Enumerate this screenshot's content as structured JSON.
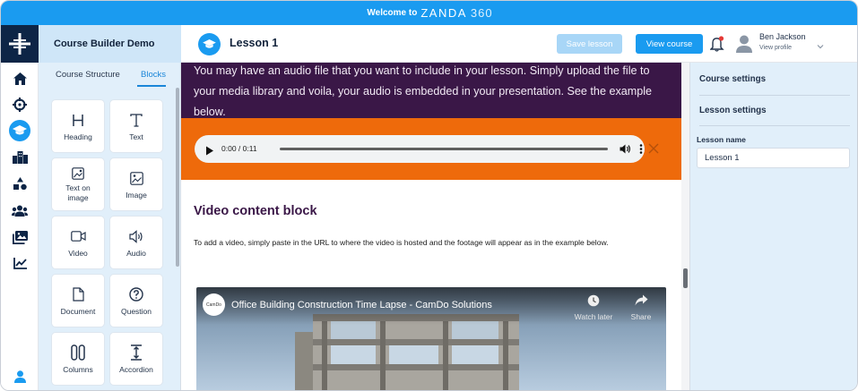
{
  "banner": {
    "welcome": "Welcome to",
    "brand": "ZANDA",
    "brand_num": "360"
  },
  "nav": {
    "icons": [
      "home-icon",
      "target-icon",
      "graduation-cap-icon",
      "buildings-icon",
      "shapes-icon",
      "users-icon",
      "images-icon",
      "chart-line-icon",
      "user-icon"
    ],
    "active": "graduation-cap-icon"
  },
  "builder": {
    "title": "Course Builder Demo",
    "tabs": [
      {
        "label": "Course Structure"
      },
      {
        "label": "Blocks"
      }
    ],
    "active_tab": "Blocks",
    "blocks": [
      {
        "label": "Heading",
        "icon": "heading-icon"
      },
      {
        "label": "Text",
        "icon": "text-icon"
      },
      {
        "label": "Text on image",
        "icon": "image-text-icon"
      },
      {
        "label": "Image",
        "icon": "image-icon"
      },
      {
        "label": "Video",
        "icon": "video-icon"
      },
      {
        "label": "Audio",
        "icon": "audio-icon"
      },
      {
        "label": "Document",
        "icon": "document-icon"
      },
      {
        "label": "Question",
        "icon": "question-icon"
      },
      {
        "label": "Columns",
        "icon": "columns-icon"
      },
      {
        "label": "Accordion",
        "icon": "accordion-icon"
      }
    ]
  },
  "header": {
    "lesson_title": "Lesson 1",
    "save_label": "Save lesson",
    "view_label": "View course",
    "user_name": "Ben Jackson",
    "user_profile": "View profile"
  },
  "content": {
    "purple_text": "You may have an audio file that you want to include in your lesson. Simply upload the file to your media library and voila, your audio is embedded in your presentation. See the example below.",
    "audio": {
      "time": "0:00 / 0:11"
    },
    "video_heading": "Video content block",
    "video_desc": "To add a video, simply paste in the URL to where the video is hosted and the footage will appear as in the example below.",
    "video": {
      "title": "Office Building Construction Time Lapse - CamDo Solutions",
      "channel": "CamDo",
      "watch_later": "Watch later",
      "share": "Share"
    }
  },
  "settings": {
    "course_settings": "Course settings",
    "lesson_settings": "Lesson settings",
    "lesson_name_label": "Lesson name",
    "lesson_name_value": "Lesson 1"
  },
  "colors": {
    "accent": "#1a9bf0",
    "nav_dark": "#0d2546",
    "purple_block": "#3a1747",
    "orange_block": "#ee6a0b",
    "panel_bg": "#e1effa"
  }
}
